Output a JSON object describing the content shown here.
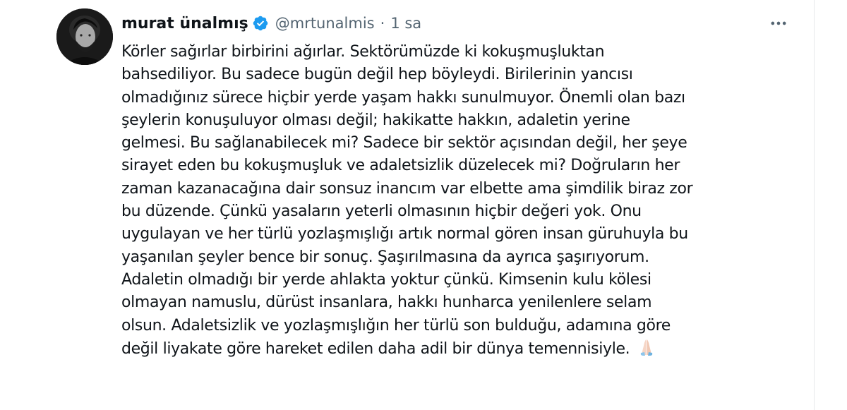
{
  "user": {
    "display_name": "murat ünalmış",
    "handle": "@mrtunalmis",
    "separator": "·",
    "time": "1 sa"
  },
  "icons": {
    "verified": "verified-badge-icon",
    "more": "more-options-icon",
    "emoji": "folded-hands-emoji-icon",
    "verified_color": "#1d9bf0"
  },
  "tweet": {
    "lines": [
      "Körler sağırlar birbirini ağırlar. Sektörümüzde ki kokuşmuşluktan",
      "bahsediliyor. Bu sadece bugün değil hep böyleydi. Birilerinin yancısı",
      "olmadığınız sürece hiçbir yerde yaşam hakkı sunulmuyor. Önemli olan bazı",
      "şeylerin konuşuluyor olması değil;  hakikatte hakkın, adaletin yerine",
      "gelmesi. Bu sağlanabilecek mi? Sadece bir sektör açısından değil, her şeye",
      "sirayet eden bu kokuşmuşluk ve adaletsizlik düzelecek mi? Doğruların her",
      "zaman kazanacağına dair sonsuz inancım var elbette ama şimdilik biraz zor",
      "bu düzende. Çünkü yasaların yeterli olmasının hiçbir değeri yok. Onu",
      "uygulayan ve her türlü yozlaşmışlığı artık normal gören insan güruhuyla bu",
      "yaşanılan şeyler bence bir sonuç. Şaşırılmasına da ayrıca şaşırıyorum.",
      "Adaletin olmadığı bir yerde ahlakta yoktur çünkü. Kimsenin kulu kölesi",
      "olmayan namuslu, dürüst insanlara, hakkı hunharca yenilenlere selam",
      "olsun. Adaletsizlik ve yozlaşmışlığın her türlü son bulduğu, adamına göre",
      "değil  liyakate göre hareket edilen daha adil bir dünya temennisiyle."
    ]
  }
}
